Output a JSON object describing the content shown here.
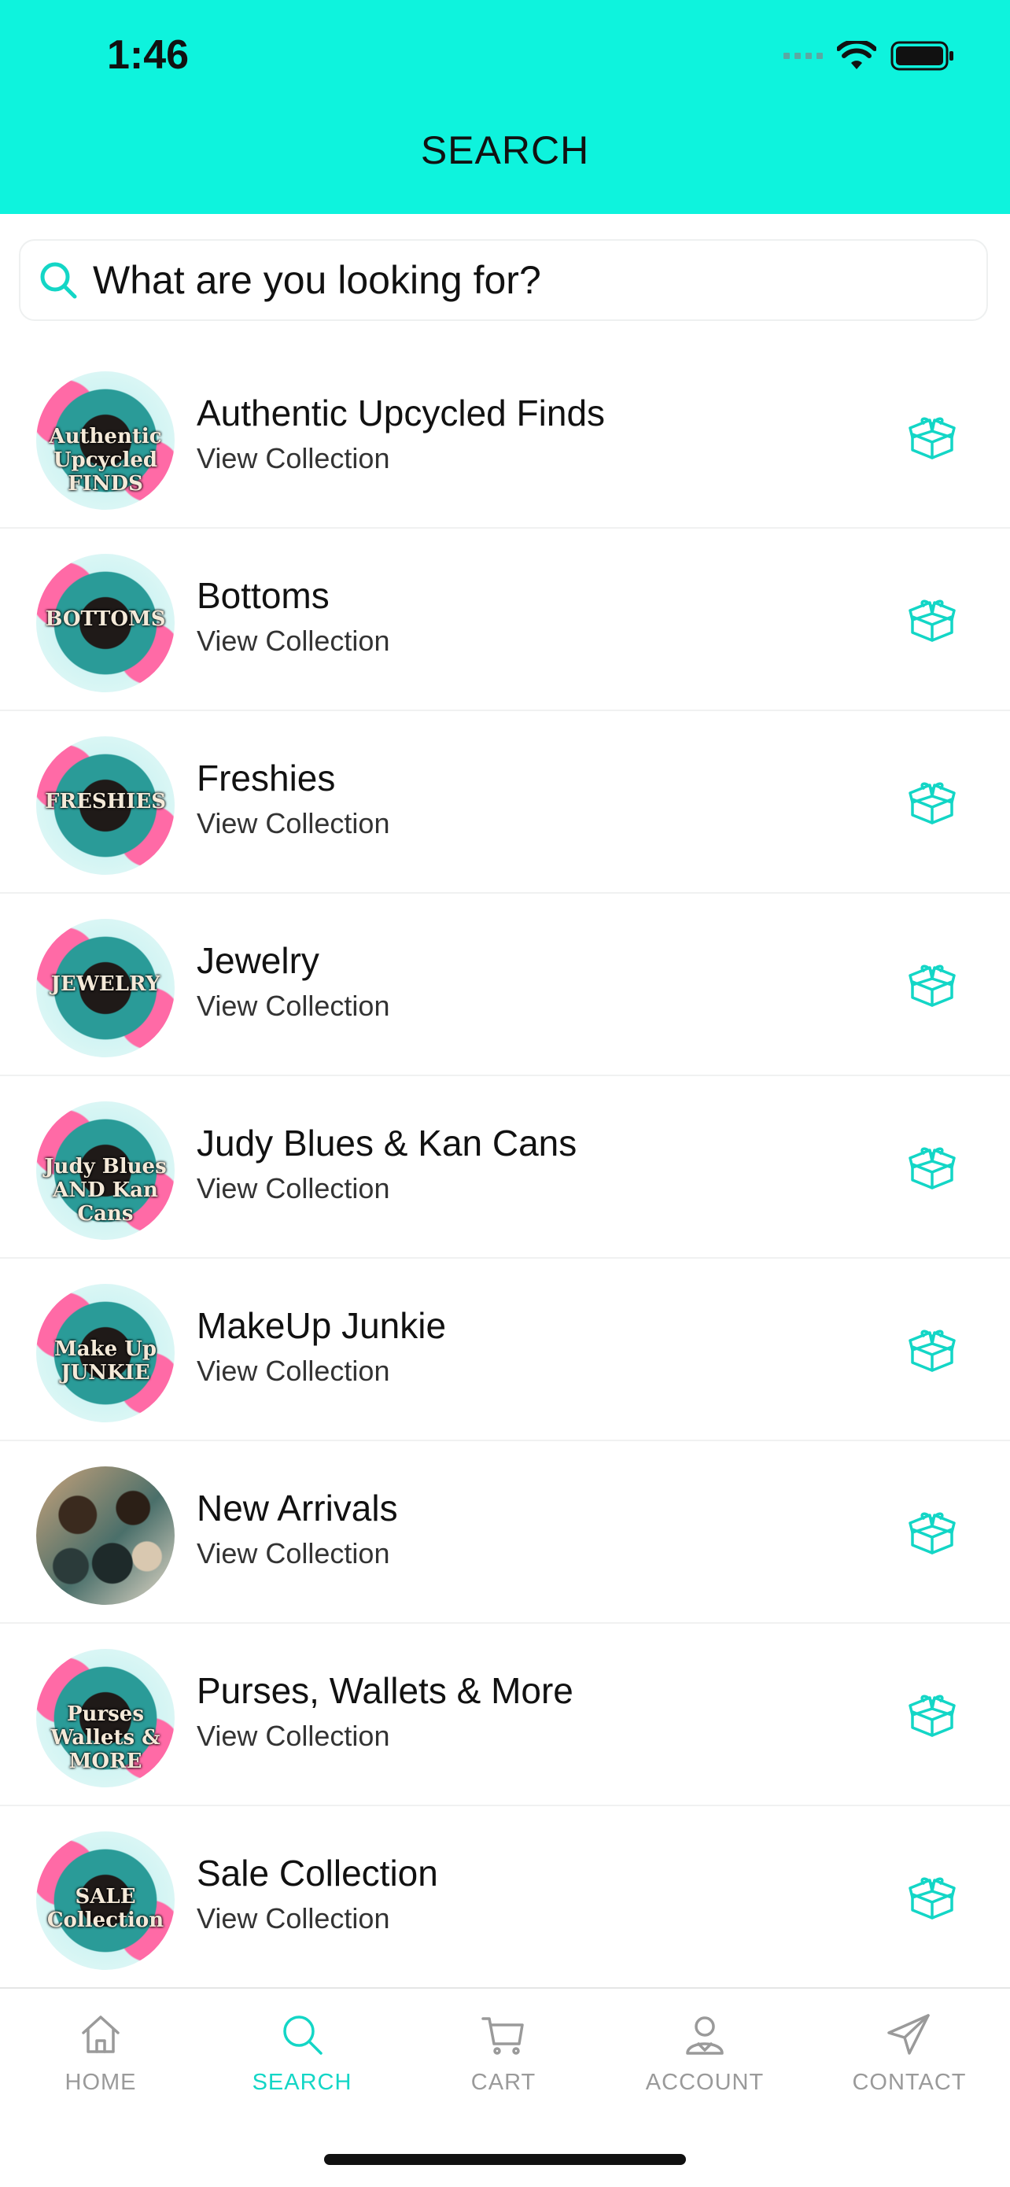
{
  "status": {
    "time": "1:46"
  },
  "header": {
    "title": "SEARCH"
  },
  "search": {
    "placeholder": "What are you looking for?"
  },
  "collections": [
    {
      "title": "Authentic Upcycled Finds",
      "subtitle": "View Collection",
      "badge": "Authentic Upcycled FINDS",
      "style": "teal-pink"
    },
    {
      "title": "Bottoms",
      "subtitle": "View Collection",
      "badge": "BOTTOMS",
      "style": "teal-pink"
    },
    {
      "title": "Freshies",
      "subtitle": "View Collection",
      "badge": "FRESHIES",
      "style": "teal-pink"
    },
    {
      "title": "Jewelry",
      "subtitle": "View Collection",
      "badge": "JEWELRY",
      "style": "teal-pink"
    },
    {
      "title": "Judy Blues & Kan Cans",
      "subtitle": "View Collection",
      "badge": "Judy Blues AND Kan Cans",
      "style": "teal-pink"
    },
    {
      "title": "MakeUp Junkie",
      "subtitle": "View Collection",
      "badge": "Make Up JUNKIE",
      "style": "teal-pink"
    },
    {
      "title": "New Arrivals",
      "subtitle": "View Collection",
      "badge": "",
      "style": "leopard"
    },
    {
      "title": "Purses, Wallets & More",
      "subtitle": "View Collection",
      "badge": "Purses Wallets & MORE",
      "style": "teal-pink"
    },
    {
      "title": "Sale Collection",
      "subtitle": "View Collection",
      "badge": "SALE Collection",
      "style": "teal-pink"
    }
  ],
  "tabs": [
    {
      "label": "HOME",
      "icon": "home-icon",
      "active": false
    },
    {
      "label": "SEARCH",
      "icon": "search-icon",
      "active": true
    },
    {
      "label": "CART",
      "icon": "cart-icon",
      "active": false
    },
    {
      "label": "ACCOUNT",
      "icon": "account-icon",
      "active": false
    },
    {
      "label": "CONTACT",
      "icon": "send-icon",
      "active": false
    }
  ],
  "colors": {
    "accent": "#0ef3dd",
    "active_tab": "#13d6c6",
    "inactive_tab": "#9a9a9a"
  }
}
